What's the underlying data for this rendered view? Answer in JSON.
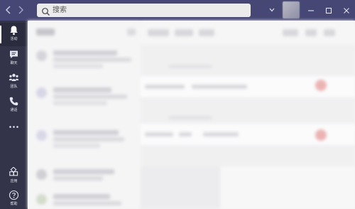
{
  "window": {
    "search": {
      "placeholder": "搜索",
      "value": ""
    }
  },
  "rail": {
    "items": [
      {
        "label": "活动",
        "icon": "bell-icon",
        "active": true
      },
      {
        "label": "聊天",
        "icon": "chat-icon",
        "active": false
      },
      {
        "label": "团队",
        "icon": "teams-icon",
        "active": false
      },
      {
        "label": "通话",
        "icon": "phone-icon",
        "active": false
      },
      {
        "label": "",
        "icon": "more-icon",
        "active": false
      }
    ],
    "bottom": [
      {
        "label": "应用",
        "icon": "apps-icon"
      },
      {
        "label": "帮助",
        "icon": "help-icon"
      }
    ]
  },
  "colors": {
    "titlebar": "#464775",
    "rail": "#33344a",
    "accent": "#ecb3b3"
  }
}
